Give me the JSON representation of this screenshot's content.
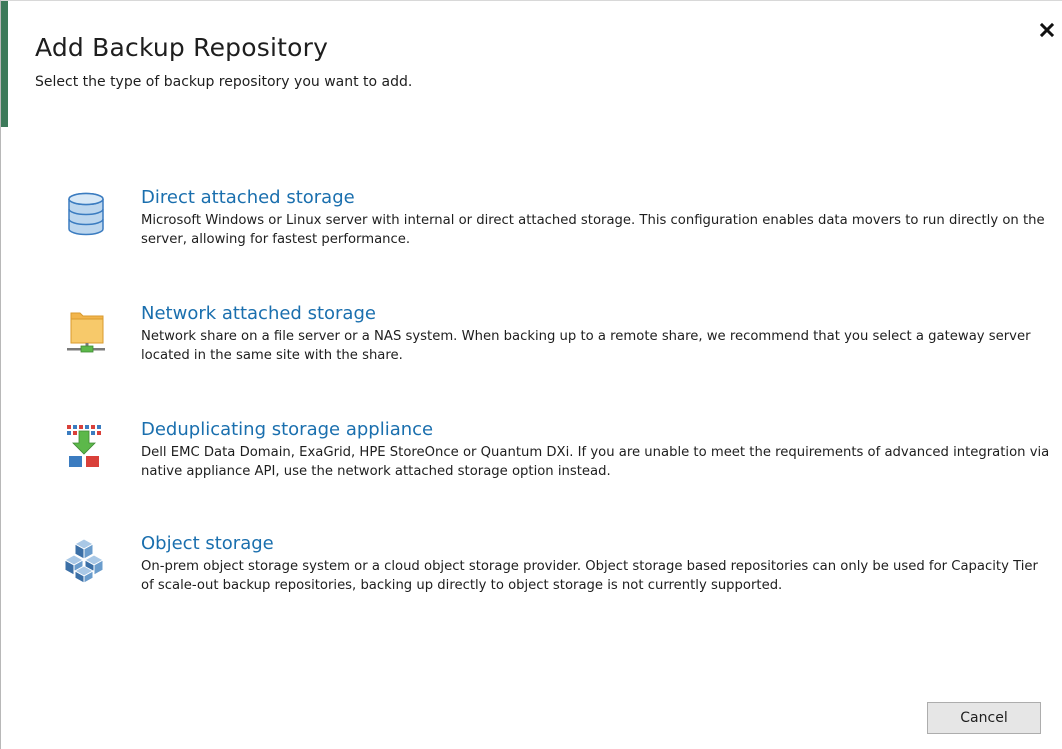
{
  "dialog": {
    "title": "Add Backup Repository",
    "subtitle": "Select the type of backup repository you want to add.",
    "accent_color": "#3d7a5a",
    "link_color": "#1a6fae"
  },
  "options": [
    {
      "label": "Direct attached storage",
      "description": "Microsoft Windows or Linux server with internal or direct attached storage. This configuration enables data movers to run directly on the server, allowing for fastest performance.",
      "icon": "database-icon"
    },
    {
      "label": "Network attached storage",
      "description": "Network share on a file server or a NAS system. When backing up to a remote share, we recommend that you select a gateway server located in the same site with the share.",
      "icon": "network-folder-icon"
    },
    {
      "label": "Deduplicating storage appliance",
      "description": "Dell EMC Data Domain, ExaGrid, HPE StoreOnce or Quantum DXi. If you are unable to meet the requirements of advanced integration via native appliance API, use the network attached storage option instead.",
      "icon": "deduplication-icon"
    },
    {
      "label": "Object storage",
      "description": "On-prem object storage system or a cloud object storage provider. Object storage based repositories can only be used for Capacity Tier of scale-out backup repositories, backing up directly to object storage is not currently supported.",
      "icon": "object-storage-icon"
    }
  ],
  "buttons": {
    "cancel_label": "Cancel",
    "close_icon": "close-icon"
  }
}
